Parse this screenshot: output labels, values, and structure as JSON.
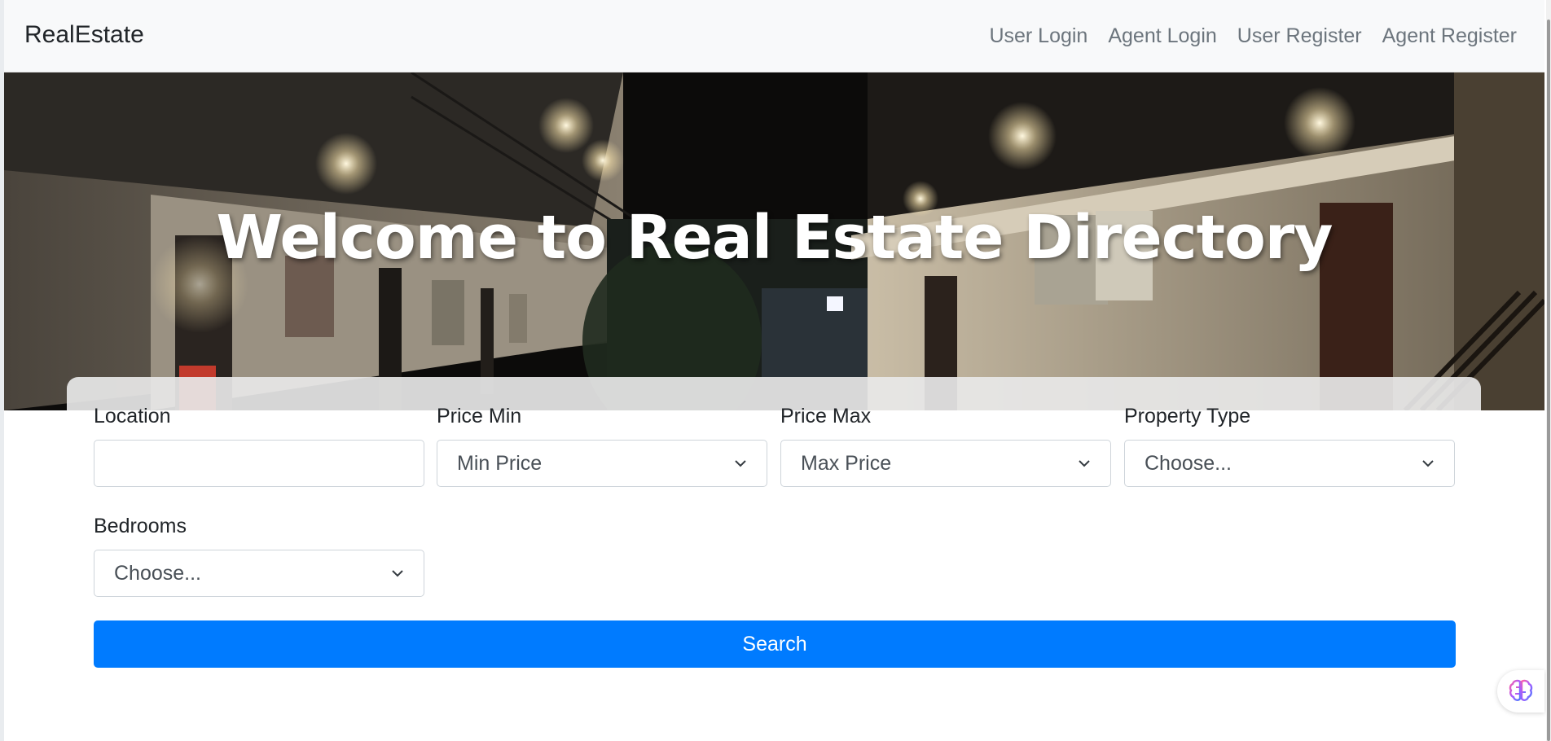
{
  "navbar": {
    "brand": "RealEstate",
    "links": [
      "User Login",
      "Agent Login",
      "User Register",
      "Agent Register"
    ]
  },
  "hero": {
    "title": "Welcome to Real Estate Directory"
  },
  "search_form": {
    "location": {
      "label": "Location",
      "value": ""
    },
    "price_min": {
      "label": "Price Min",
      "selected": "Min Price"
    },
    "price_max": {
      "label": "Price Max",
      "selected": "Max Price"
    },
    "property_type": {
      "label": "Property Type",
      "selected": "Choose..."
    },
    "bedrooms": {
      "label": "Bedrooms",
      "selected": "Choose..."
    },
    "submit_label": "Search"
  },
  "colors": {
    "primary": "#007bff",
    "navbar_bg": "#f8f9fa",
    "nav_link": "#6c757d"
  },
  "icons": {
    "assistant": "brain-icon",
    "select_arrow": "chevron-down-icon"
  }
}
